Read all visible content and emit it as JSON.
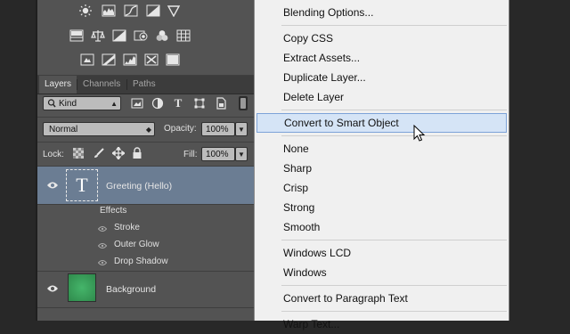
{
  "panel": {
    "adjustment_icons": [
      [
        "brightness-contrast-icon",
        "levels-icon",
        "curves-icon",
        "exposure-icon",
        "vibrance-icon"
      ],
      [
        "hue-saturation-icon",
        "color-balance-icon",
        "black-white-icon",
        "photo-filter-icon",
        "channel-mixer-icon",
        "color-lookup-icon"
      ],
      [
        "invert-icon",
        "posterize-icon",
        "threshold-icon",
        "selective-color-icon",
        "gradient-map-icon"
      ]
    ],
    "tabs": [
      {
        "label": "Layers",
        "active": true
      },
      {
        "label": "Channels",
        "active": false
      },
      {
        "label": "Paths",
        "active": false
      }
    ],
    "filter": {
      "label": "Kind"
    },
    "blend_mode": "Normal",
    "opacity_label": "Opacity:",
    "opacity_value": "100%",
    "lock_label": "Lock:",
    "fill_label": "Fill:",
    "fill_value": "100%"
  },
  "layers": [
    {
      "name": "Greeting (Hello)",
      "type": "text",
      "selected": true,
      "thumb_glyph": "T",
      "effects_label": "Effects",
      "effects": [
        "Stroke",
        "Outer Glow",
        "Drop Shadow"
      ]
    },
    {
      "name": "Background",
      "type": "image",
      "selected": false,
      "thumb_color": "#3a9a58"
    }
  ],
  "menu": {
    "items": [
      {
        "label": "Blending Options...",
        "group": 1
      },
      {
        "label": "Copy CSS",
        "group": 2
      },
      {
        "label": "Extract Assets...",
        "group": 2
      },
      {
        "label": "Duplicate Layer...",
        "group": 2
      },
      {
        "label": "Delete Layer",
        "group": 2
      },
      {
        "label": "Convert to Smart Object",
        "group": 3,
        "highlighted": true
      },
      {
        "label": "None",
        "group": 4
      },
      {
        "label": "Sharp",
        "group": 4
      },
      {
        "label": "Crisp",
        "group": 4
      },
      {
        "label": "Strong",
        "group": 4
      },
      {
        "label": "Smooth",
        "group": 4
      },
      {
        "label": "Windows LCD",
        "group": 5
      },
      {
        "label": "Windows",
        "group": 5
      },
      {
        "label": "Convert to Paragraph Text",
        "group": 6
      },
      {
        "label": "Warp Text...",
        "group": 7
      }
    ]
  },
  "colors": {
    "panel_bg": "#535353",
    "selected_layer": "#6b7d93",
    "menu_bg": "#f0f0f0",
    "menu_highlight": "#d5e4f6",
    "menu_highlight_border": "#7da3d8"
  }
}
